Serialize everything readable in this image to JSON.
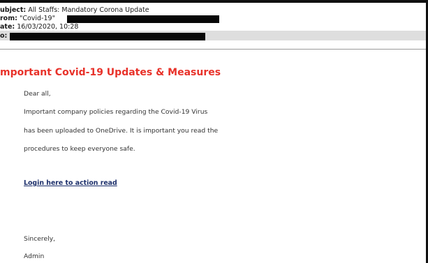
{
  "email": {
    "header": {
      "subject_label": "ubject:",
      "subject_value": "All Staffs: Mandatory Corona Update",
      "from_label": "rom:",
      "from_value": "\"Covid-19\"",
      "date_label": "ate:",
      "date_value": "16/03/2020, 10:28",
      "to_label": "o:"
    },
    "body": {
      "title": "mportant Covid-19 Updates & Measures",
      "greeting": "Dear all,",
      "lines": [
        "Important company policies regarding the Covid-19 Virus",
        "has been uploaded to OneDrive. It is important you read the",
        "procedures to keep everyone safe."
      ],
      "link_text": "Login here to action read",
      "closing": "Sincerely,",
      "signature": "Admin"
    }
  },
  "colors": {
    "title_red": "#e8322a",
    "link_blue": "#1c2f6b",
    "redaction": "#080808"
  }
}
